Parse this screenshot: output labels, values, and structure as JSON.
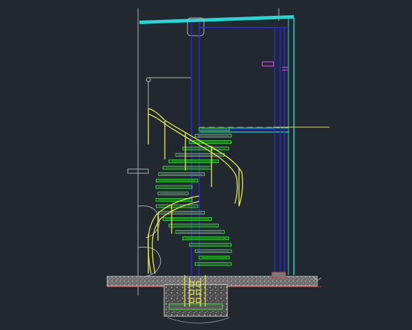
{
  "drawing": {
    "type": "cad-elevation",
    "subject": "spiral-staircase",
    "background_color": "#212830",
    "colors": {
      "outline": "#b4b4b4",
      "column": "#2a2ae8",
      "structure": "#2bd4d4",
      "railing": "#f0f04a",
      "treads": "#39e639",
      "marker": "#e040e0",
      "section_line": "#e0e040",
      "foundation_rebar": "#f0f04a",
      "cut_line": "#e03030"
    },
    "tread_count": 22,
    "visible_text": []
  }
}
